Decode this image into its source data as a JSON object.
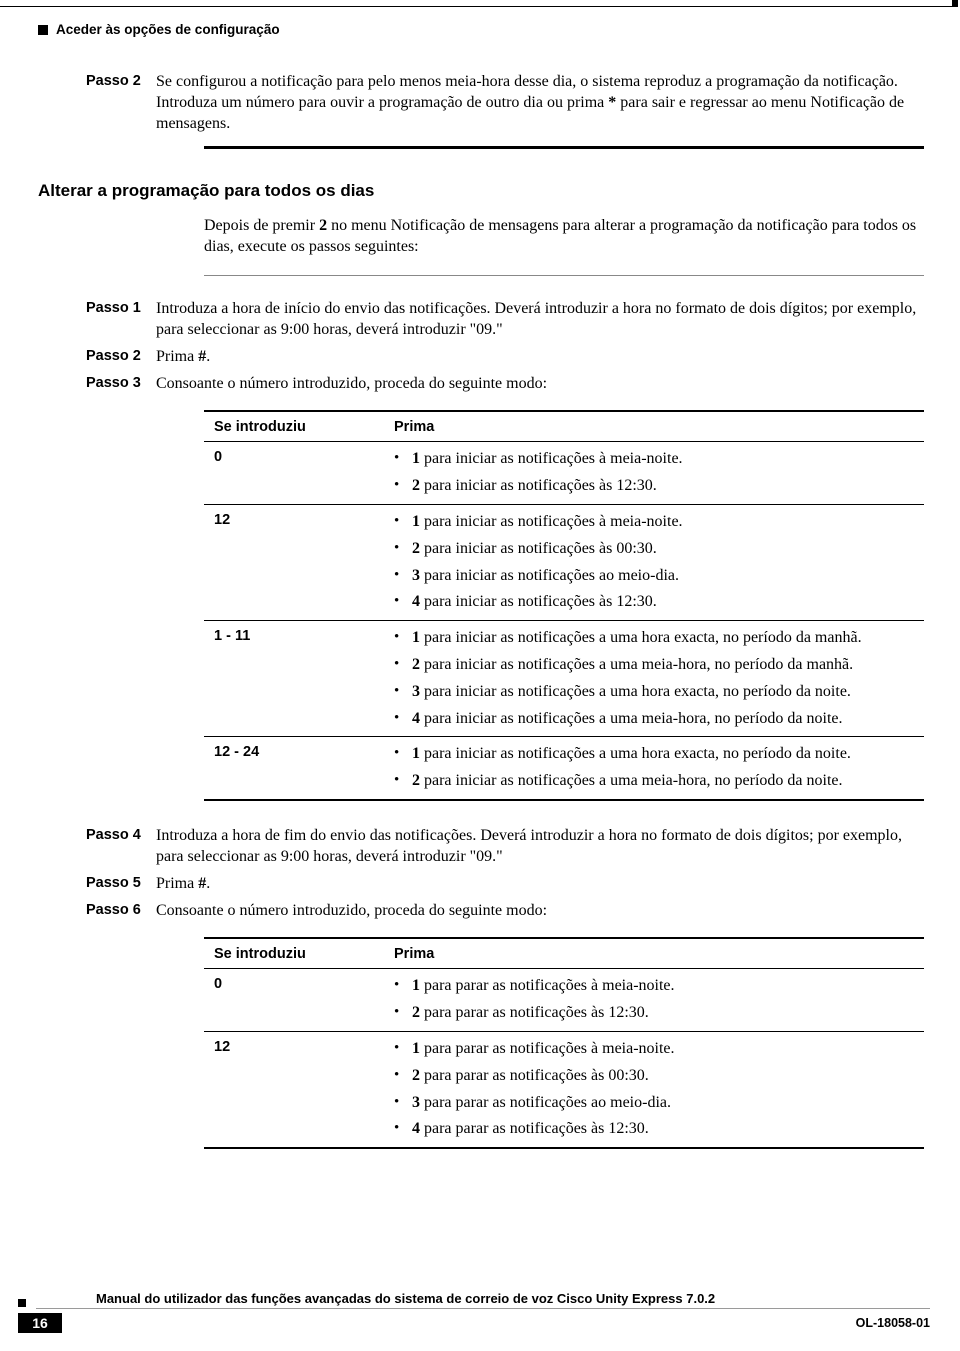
{
  "header": {
    "section_title": "Aceder às opções de configuração"
  },
  "block1": {
    "step2": {
      "label": "Passo 2",
      "text_a": "Se configurou a notificação para pelo menos meia-hora desse dia, o sistema reproduz a programação da notificação.",
      "text_b_pre": "Introduza um número para ouvir a programação de outro dia ou prima ",
      "text_b_key": "*",
      "text_b_post": " para sair e regressar ao menu Notificação de mensagens."
    }
  },
  "section2": {
    "heading": "Alterar a programação para todos os dias",
    "intro_pre": "Depois de premir ",
    "intro_key": "2",
    "intro_post": " no menu Notificação de mensagens para alterar a programação da notificação para todos os dias, execute os passos seguintes:",
    "step1": {
      "label": "Passo 1",
      "text": "Introduza a hora de início do envio das notificações. Deverá introduzir a hora no formato de dois dígitos; por exemplo, para seleccionar as 9:00 horas, deverá introduzir \"09.\""
    },
    "step2": {
      "label": "Passo 2",
      "text_pre": "Prima ",
      "text_key": "#",
      "text_post": "."
    },
    "step3": {
      "label": "Passo 3",
      "text": "Consoante o número introduzido, proceda do seguinte modo:"
    },
    "step4": {
      "label": "Passo 4",
      "text": "Introduza a hora de fim do envio das notificações. Deverá introduzir a hora no formato de dois dígitos; por exemplo, para seleccionar as 9:00 horas, deverá introduzir \"09.\""
    },
    "step5": {
      "label": "Passo 5",
      "text_pre": "Prima ",
      "text_key": "#",
      "text_post": "."
    },
    "step6": {
      "label": "Passo 6",
      "text": "Consoante o número introduzido, proceda do seguinte modo:"
    }
  },
  "table1": {
    "col_a": "Se introduziu",
    "col_b": "Prima",
    "rows": [
      {
        "a": "0",
        "b": [
          {
            "k": "1",
            "t": " para iniciar as notificações à meia-noite."
          },
          {
            "k": "2",
            "t": " para iniciar as notificações às 12:30."
          }
        ]
      },
      {
        "a": "12",
        "b": [
          {
            "k": "1",
            "t": " para iniciar as notificações à meia-noite."
          },
          {
            "k": "2",
            "t": " para iniciar as notificações às 00:30."
          },
          {
            "k": "3",
            "t": " para iniciar as notificações ao meio-dia."
          },
          {
            "k": "4",
            "t": " para iniciar as notificações às 12:30."
          }
        ]
      },
      {
        "a": "1 - 11",
        "b": [
          {
            "k": "1",
            "t": " para iniciar as notificações a uma hora exacta, no período da manhã."
          },
          {
            "k": "2",
            "t": " para iniciar as notificações a uma meia-hora, no período da manhã."
          },
          {
            "k": "3",
            "t": " para iniciar as notificações a uma hora exacta, no período da noite."
          },
          {
            "k": "4",
            "t": " para iniciar as notificações a uma meia-hora, no período da noite."
          }
        ]
      },
      {
        "a": "12 - 24",
        "b": [
          {
            "k": "1",
            "t": " para iniciar as notificações a uma hora exacta, no período da noite."
          },
          {
            "k": "2",
            "t": " para iniciar as notificações a uma meia-hora, no período da noite."
          }
        ]
      }
    ]
  },
  "table2": {
    "col_a": "Se introduziu",
    "col_b": "Prima",
    "rows": [
      {
        "a": "0",
        "b": [
          {
            "k": "1",
            "t": " para parar as notificações à meia-noite."
          },
          {
            "k": "2",
            "t": " para parar as notificações às 12:30."
          }
        ]
      },
      {
        "a": "12",
        "b": [
          {
            "k": "1",
            "t": " para parar as notificações à meia-noite."
          },
          {
            "k": "2",
            "t": " para parar as notificações às 00:30."
          },
          {
            "k": "3",
            "t": " para parar as notificações ao meio-dia."
          },
          {
            "k": "4",
            "t": " para parar as notificações às 12:30."
          }
        ]
      }
    ]
  },
  "footer": {
    "title": "Manual do utilizador das funções avançadas do sistema de correio de voz Cisco Unity Express 7.0.2",
    "page": "16",
    "doc_id": "OL-18058-01"
  }
}
